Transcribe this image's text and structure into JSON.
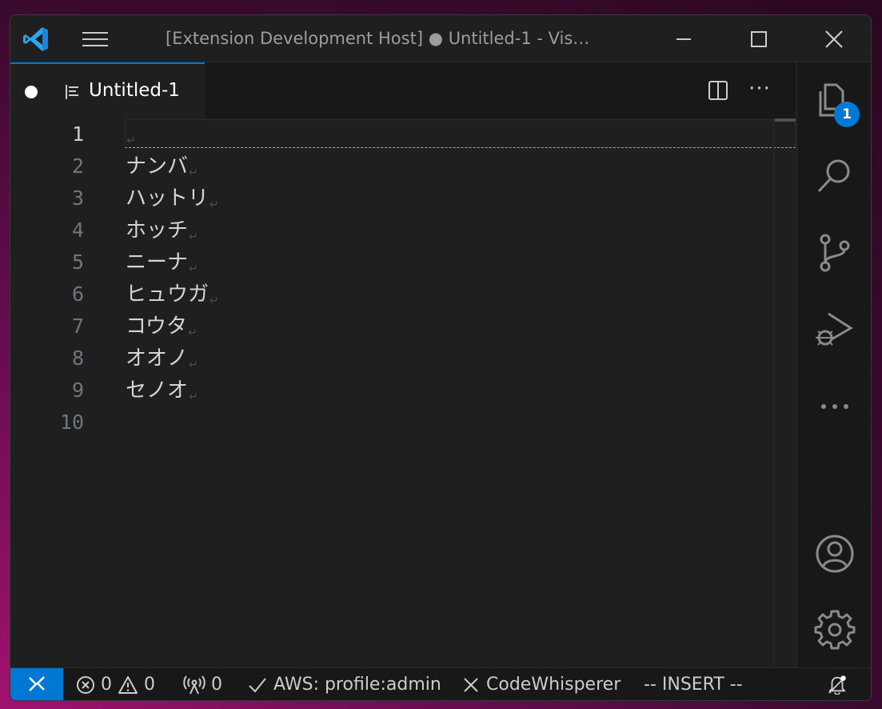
{
  "titlebar": {
    "title": "[Extension Development Host] ● Untitled-1 - Vis…"
  },
  "tab": {
    "label": "Untitled-1",
    "dirty": true
  },
  "editor": {
    "line_numbers": [
      "1",
      "2",
      "3",
      "4",
      "5",
      "6",
      "7",
      "8",
      "9",
      "10"
    ],
    "lines": [
      "",
      "ナンバ",
      "ハットリ",
      "ホッチ",
      "ニーナ",
      "ヒュウガ",
      "コウタ",
      "オオノ",
      "セノオ"
    ],
    "eol_marker": "↵",
    "active_line": 1
  },
  "activity": {
    "explorer_badge": "1"
  },
  "statusbar": {
    "errors": "0",
    "warnings": "0",
    "ports": "0",
    "aws": "AWS: profile:admin",
    "codewhisperer": "CodeWhisperer",
    "mode": "-- INSERT --"
  },
  "colors": {
    "accent": "#0078d4",
    "editor_bg": "#1f1f1f",
    "sidebar_bg": "#181818",
    "cursor_line": "#5fd0b4"
  }
}
